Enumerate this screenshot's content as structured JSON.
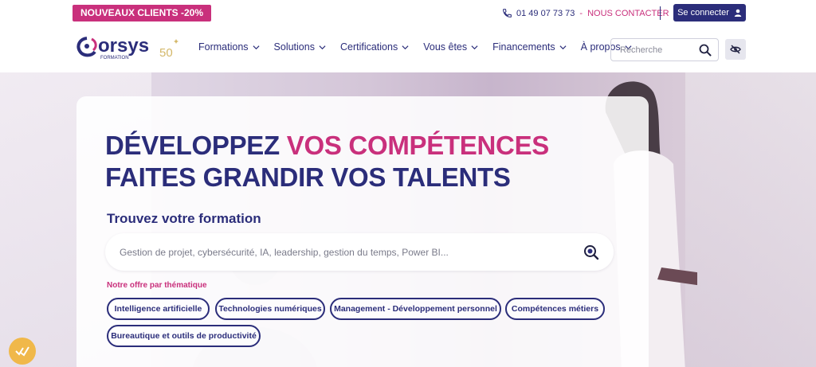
{
  "topbar": {
    "promo": "NOUVEAUX CLIENTS -20%",
    "phone": "01 49 07 73 73",
    "separator": "-",
    "contact": "NOUS CONTACTER",
    "login": "Se connecter"
  },
  "nav": {
    "items": [
      {
        "label": "Formations"
      },
      {
        "label": "Solutions"
      },
      {
        "label": "Certifications"
      },
      {
        "label": "Vous êtes"
      },
      {
        "label": "Financements"
      },
      {
        "label": "À propos"
      }
    ],
    "search_placeholder": "Recherche"
  },
  "logo": {
    "text": "orsys",
    "sub": "FORMATION",
    "badge": "50"
  },
  "hero": {
    "title_line1_a": "DÉVELOPPEZ",
    "title_line1_b": "VOS COMPÉTENCES",
    "title_line2": "FAITES GRANDIR VOS TALENTS",
    "find_label": "Trouvez votre formation",
    "search_placeholder": "Gestion de projet, cybersécurité, IA, leadership, gestion du temps, Power BI...",
    "offer_label": "Notre offre par thématique",
    "chips": [
      {
        "label": "Intelligence artificielle"
      },
      {
        "label": "Technologies numériques"
      },
      {
        "label": "Management - Développement personnel"
      },
      {
        "label": "Compétences métiers"
      },
      {
        "label": "Bureautique et outils de productivité"
      }
    ]
  },
  "colors": {
    "brand_blue": "#2b2d7a",
    "brand_pink": "#c9307c",
    "cookie": "#f0b84a"
  },
  "icons": {
    "phone": "phone-icon",
    "user": "user-icon",
    "search": "search-icon",
    "eye": "eye-slash-icon",
    "chevron": "chevron-down-icon",
    "cookie": "cookie-check-icon"
  }
}
